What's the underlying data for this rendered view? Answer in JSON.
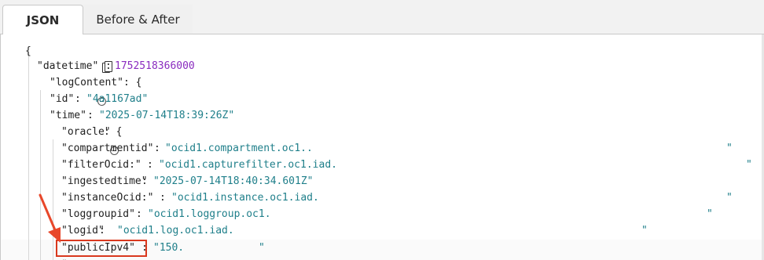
{
  "tabs": [
    {
      "label": "JSON",
      "active": true
    },
    {
      "label": "Before & After",
      "active": false
    }
  ],
  "json": {
    "open_brace": "{",
    "datetime_key": "\"datetime\"",
    "datetime_value": "1752518366000",
    "logContent_key": "\"logContent\"",
    "id_key": "\"id\"",
    "id_value": "\"4a1167ad\"",
    "time_key": "\"time\"",
    "time_value": "\"2025-07-14T18:39:26Z\"",
    "oracle_key": "\"oracle\"",
    "compartmentid_key": "\"compartmentid\"",
    "compartmentid_value": "\"ocid1.compartment.oc1..",
    "filterOcid_key": "\"filterOcid:\"",
    "filterOcid_value": "\"ocid1.capturefilter.oc1.iad.",
    "ingestedtime_key": "\"ingestedtime\"",
    "ingestedtime_value": "\"2025-07-14T18:40:34.601Z\"",
    "instanceOcid_key": "\"instanceOcid:\"",
    "instanceOcid_value": "\"ocid1.instance.oc1.iad.",
    "loggroupid_key": "\"loggroupid\"",
    "loggroupid_value": "\"ocid1.loggroup.oc1.",
    "logid_key": "\"logid\"",
    "logid_value": "\"ocid1.log.oc1.iad.",
    "publicIpv4_key": "\"publicIpv4\"",
    "publicIpv4_value": "\"150.",
    "closing_quote": "\"",
    "colon": ": ",
    "colon_brace": ": {",
    "comma": ","
  },
  "colors": {
    "number": "#8a2bbf",
    "string": "#1f7f8a",
    "highlight": "#d9381e",
    "arrow": "#e8472a"
  },
  "icons": {
    "copy": "copy-icon",
    "collapse": "collapse-toggle-icon",
    "annotation_arrow": "annotation-arrow-icon"
  }
}
